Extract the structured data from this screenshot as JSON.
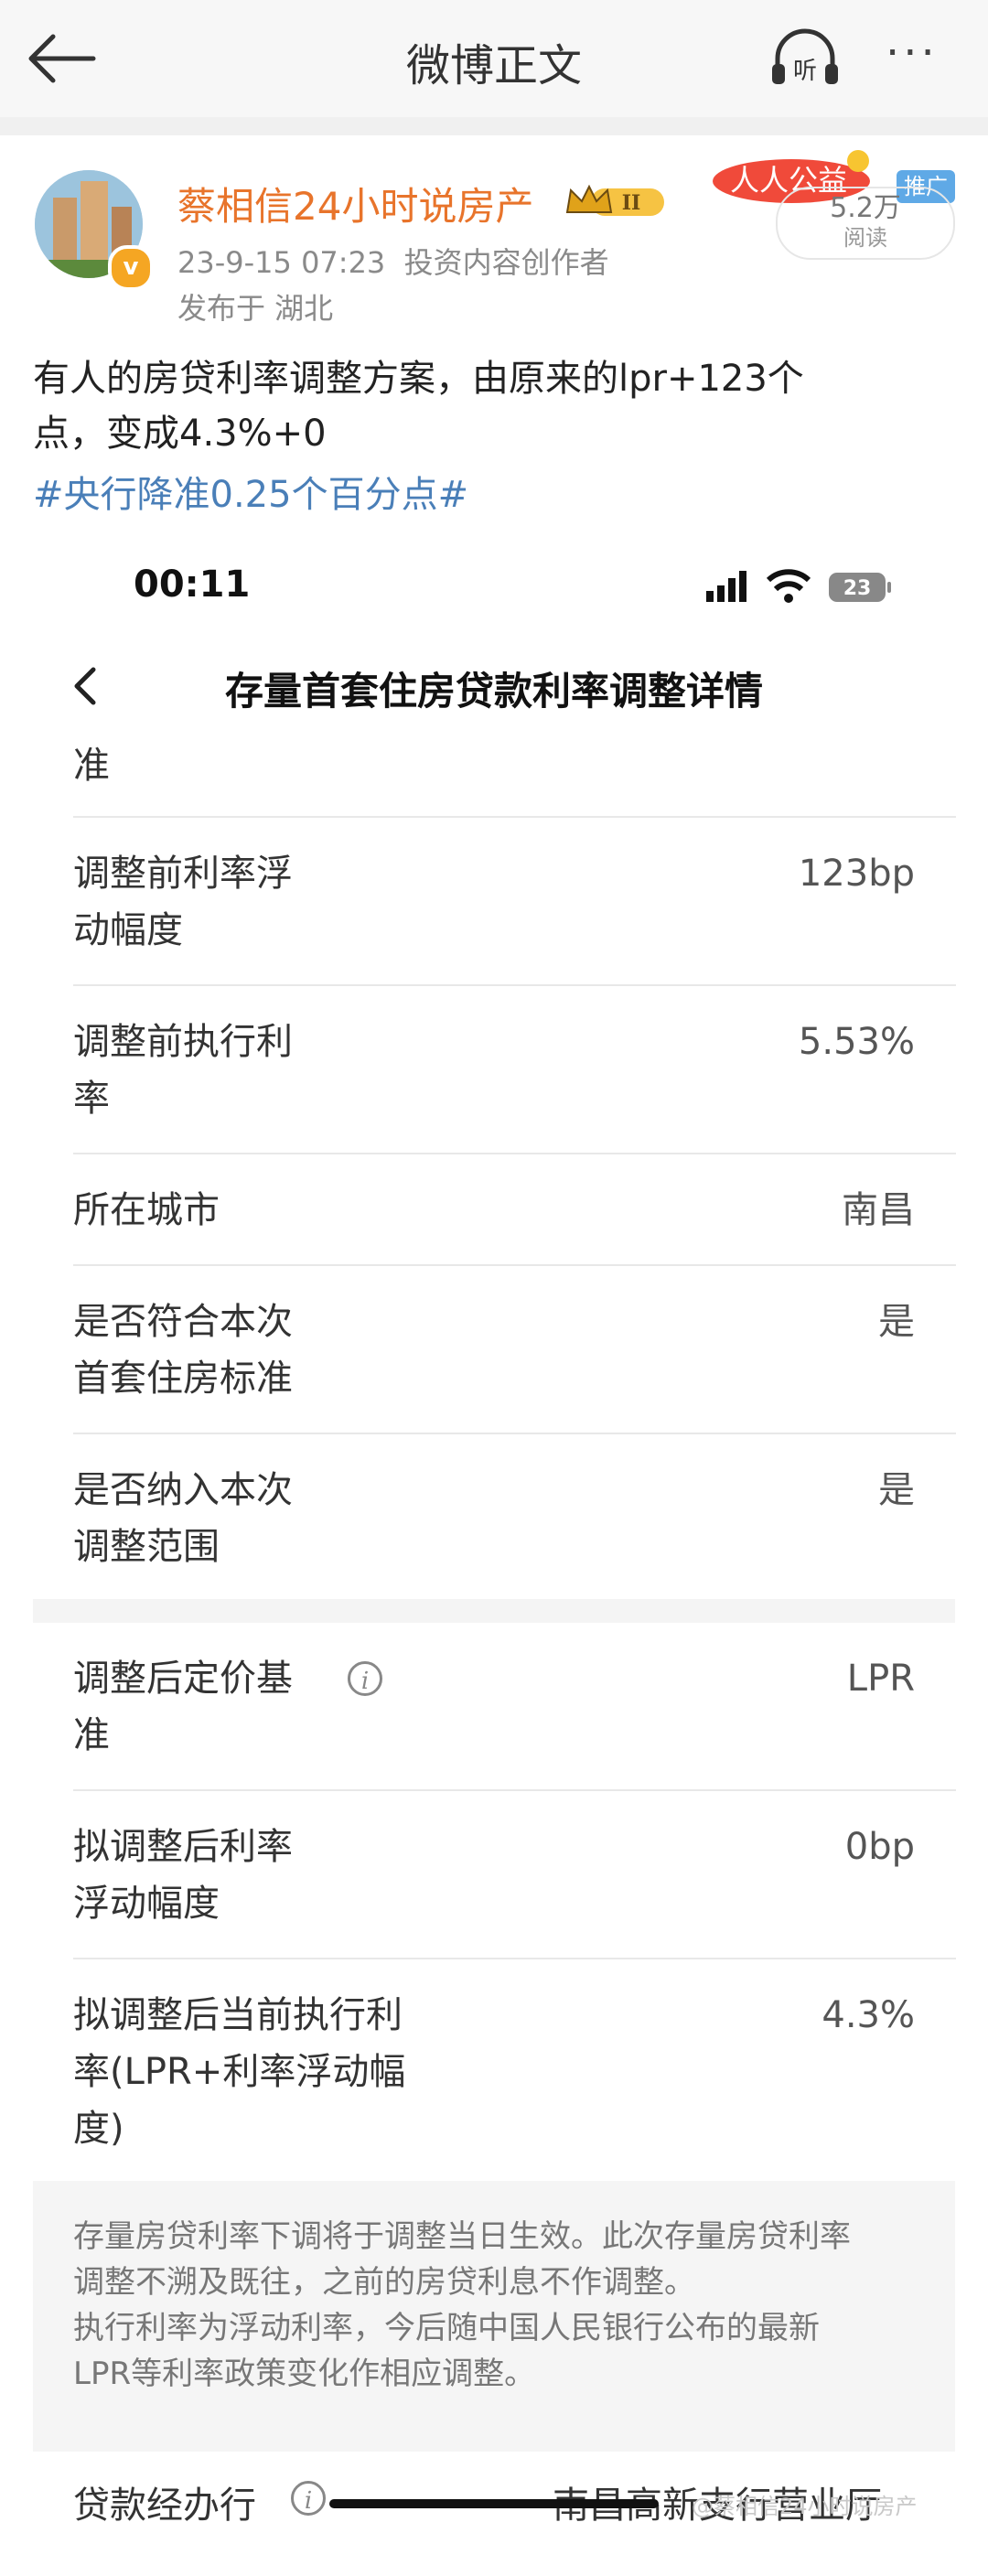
{
  "header": {
    "title": "微博正文",
    "back_icon": "arrow-left-icon",
    "listen_icon": "headphones-icon",
    "listen_label": "听",
    "more_label": "···"
  },
  "author": {
    "name": "蔡相信24小时说房产",
    "level_badge": "II",
    "verified_mark": "v",
    "time": "23-9-15 07:23",
    "role": "投资内容创作者",
    "location": "发布于 湖北",
    "ad_banner": "人人公益",
    "ad_tag": "推广",
    "read_count": "5.2万",
    "read_label": "阅读"
  },
  "post": {
    "text_line1": "有人的房贷利率调整方案，由原来的lpr+123个",
    "text_line2": "点，变成4.3%+0",
    "hashtag": "#央行降准0.25个百分点#"
  },
  "screenshot": {
    "time": "00:11",
    "battery": "23",
    "page_title": "存量首套住房贷款利率调整详情",
    "partial_top": "准",
    "rows": [
      {
        "label1": "调整前利率浮",
        "label2": "动幅度",
        "value": "123bp"
      },
      {
        "label1": "调整前执行利",
        "label2": "率",
        "value": "5.53%"
      },
      {
        "label1": "所在城市",
        "label2": "",
        "value": "南昌"
      },
      {
        "label1": "是否符合本次",
        "label2": "首套住房标准",
        "value": "是"
      },
      {
        "label1": "是否纳入本次",
        "label2": "调整范围",
        "value": "是"
      }
    ],
    "rows2": [
      {
        "label1": "调整后定价基",
        "label2": "准",
        "value": "LPR"
      },
      {
        "label1": "拟调整后利率",
        "label2": "浮动幅度",
        "value": "0bp"
      },
      {
        "label1": "拟调整后当前执行利",
        "label2": "率(LPR+利率浮动幅",
        "label3": "度)",
        "value": "4.3%"
      }
    ],
    "note_line1": "存量房贷利率下调将于调整当日生效。此次存量房贷利率",
    "note_line2": "调整不溯及既往，之前的房贷利息不作调整。",
    "note_line3": "执行利率为浮动利率，今后随中国人民银行公布的最新",
    "note_line4": "LPR等利率政策变化作相应调整。",
    "bottom_label": "贷款经办行",
    "bottom_value": "南昌高新支行营业厅",
    "watermark": "@蔡相信24小时说房产"
  }
}
